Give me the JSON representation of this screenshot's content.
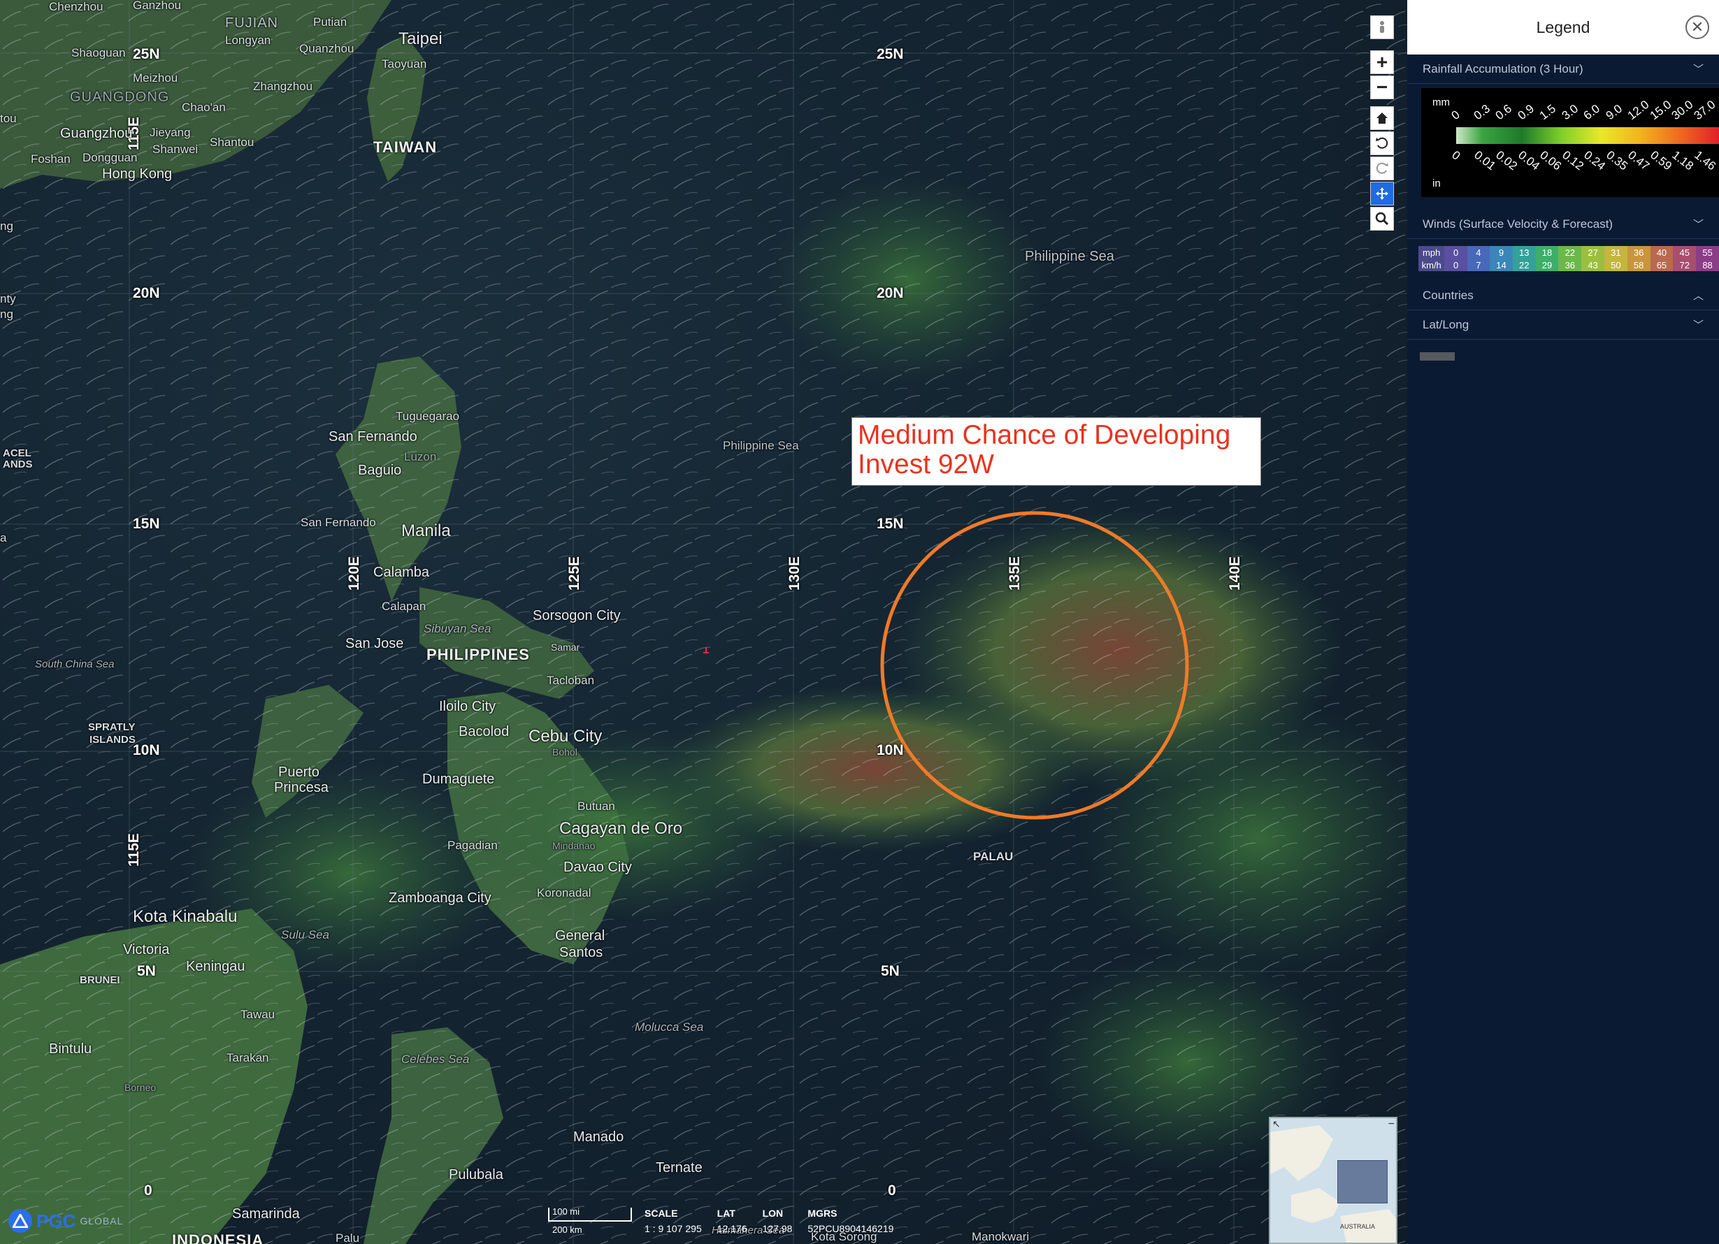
{
  "map": {
    "grid_labels": {
      "lat_left": [
        "25N",
        "20N",
        "15N",
        "10N",
        "5N",
        "0"
      ],
      "lat_right": [
        "25N",
        "20N",
        "15N",
        "10N",
        "5N",
        "0"
      ],
      "lon": [
        "115E",
        "120E",
        "125E",
        "130E",
        "135E",
        "140E"
      ],
      "lon_bottom": "115E"
    },
    "places": {
      "chenzhou": "Chenzhou",
      "ganzhou": "Ganzhou",
      "fujian": "FUJIAN",
      "putian": "Putian",
      "longyan": "Longyan",
      "quanzhou": "Quanzhou",
      "taipei": "Taipei",
      "taoyuan": "Taoyuan",
      "shaoguan": "Shaoguan",
      "meizhou": "Meizhou",
      "zhangzhou": "Zhangzhou",
      "guangdong": "GUANGDONG",
      "chaoan": "Chao'an",
      "jieyang": "Jieyang",
      "shanwei": "Shanwei",
      "shantou": "Shantou",
      "guangzhou": "Guangzhou",
      "dongguan": "Dongguan",
      "foshan": "Foshan",
      "hongkong": "Hong Kong",
      "taiwan": "TAIWAN",
      "tuguegarao": "Tuguegarao",
      "sanfernando1": "San Fernando",
      "luzon": "Luzon",
      "baguio": "Baguio",
      "sanfernando2": "San Fernando",
      "manila": "Manila",
      "calamba": "Calamba",
      "calapan": "Calapan",
      "sibuyan": "Sibuyan Sea",
      "sorsogon": "Sorsogon City",
      "sanjose": "San Jose",
      "philippines": "PHILIPPINES",
      "samar": "Samar",
      "tacloban": "Tacloban",
      "iloilo": "Iloilo City",
      "bacolod": "Bacolod",
      "cebu": "Cebu City",
      "bohol": "Bohol",
      "dumaguete": "Dumaguete",
      "butuan": "Butuan",
      "cagayan": "Cagayan de Oro",
      "mindanao": "Mindanao",
      "pagadian": "Pagadian",
      "davao": "Davao City",
      "koronadal": "Koronadal",
      "zamboanga": "Zamboanga City",
      "generalsantos1": "General",
      "generalsantos2": "Santos",
      "puertoprincesa1": "Puerto",
      "puertoprincesa2": "Princesa",
      "southchinasea": "South China Sea",
      "spratly1": "SPRATLY",
      "spratly2": "ISLANDS",
      "paracel1": "ACEL",
      "paracel2": "ANDS",
      "kotakinabalu": "Kota Kinabalu",
      "sulusea": "Sulu Sea",
      "victoria": "Victoria",
      "brunei": "BRUNEI",
      "keningau": "Keningau",
      "tawau": "Tawau",
      "tarakan": "Tarakan",
      "bintulu": "Bintulu",
      "borneo": "Borneo",
      "celebessea": "Celebes Sea",
      "moluccasea": "Molucca Sea",
      "manado": "Manado",
      "ternate": "Ternate",
      "pulubala": "Pulubala",
      "halmahera": "Halmahera Sea",
      "samarinda": "Samarinda",
      "indonesia": "INDONESIA",
      "palu": "Palu",
      "kotasorong": "Kota Sorong",
      "manokwari": "Manokwari",
      "philippinesea1": "Philippine Sea",
      "philippinesea2": "Philippine Sea",
      "palau": "PALAU",
      "cut1": "tou",
      "cut2": "ng",
      "cut3": "nty",
      "cut4": "ng",
      "cut5": "a"
    },
    "annotation": {
      "line1": "Medium Chance of Developing",
      "line2": "Invest 92W",
      "text_color": "#e8331f",
      "circle_color": "#f07a28"
    }
  },
  "toolbar": {
    "street_view": "person-icon",
    "zoom_in": "+",
    "zoom_out": "−",
    "home": "home-icon",
    "rotate_left": "rotate-left-icon",
    "rotate_right": "rotate-right-icon",
    "pan": "pan-icon",
    "zoom_box": "zoom-box-icon"
  },
  "overview": {
    "label": "AUSTRALIA",
    "close": "−",
    "collapse": "↖"
  },
  "footer": {
    "logo": "PGC",
    "logo_sub": "GLOBAL",
    "scale_top": "100 mi",
    "scale_bottom": "200 km",
    "readout_headers": [
      "SCALE",
      "LAT",
      "LON",
      "MGRS"
    ],
    "readout_values": [
      "1 : 9 107 295",
      "12.176",
      "127.98",
      "52PCU8904146219"
    ]
  },
  "legend": {
    "title": "Legend",
    "close_icon": "close-circle-icon",
    "sections": {
      "rainfall": "Rainfall Accumulation (3 Hour)",
      "winds": "Winds (Surface Velocity & Forecast)",
      "countries": "Countries",
      "latlong": "Lat/Long"
    },
    "rain_units": {
      "top": "mm",
      "bottom": "in"
    },
    "rain_mm": [
      "0",
      "0.3",
      "0.6",
      "0.9",
      "1.5",
      "3.0",
      "6.0",
      "9.0",
      "12.0",
      "15.0",
      "30.0",
      "37.0"
    ],
    "rain_in": [
      "0",
      "0.01",
      "0.02",
      "0.04",
      "0.06",
      "0.12",
      "0.24",
      "0.35",
      "0.47",
      "0.59",
      "1.18",
      "1.46"
    ],
    "wind": {
      "mph_label": "mph",
      "kmh_label": "km/h",
      "mph": [
        "0",
        "4",
        "9",
        "13",
        "18",
        "22",
        "27",
        "31",
        "36",
        "40",
        "45",
        "55"
      ],
      "kmh": [
        "0",
        "7",
        "14",
        "22",
        "29",
        "36",
        "43",
        "50",
        "58",
        "65",
        "72",
        "88"
      ],
      "colors": [
        "#5a4fa0",
        "#4868b8",
        "#3b86b8",
        "#33a19a",
        "#3fae6a",
        "#6cb84a",
        "#9cbe40",
        "#c4b63e",
        "#c9953e",
        "#b86a4e",
        "#a84e6e",
        "#8a3e86"
      ]
    }
  }
}
